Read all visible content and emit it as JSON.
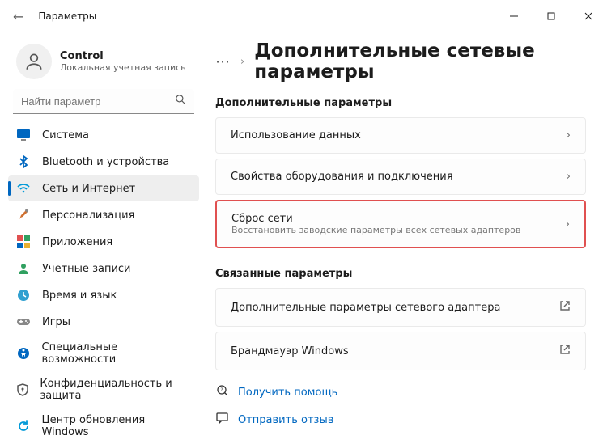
{
  "window": {
    "title": "Параметры"
  },
  "profile": {
    "name": "Control",
    "subtitle": "Локальная учетная запись"
  },
  "search": {
    "placeholder": "Найти параметр"
  },
  "sidebar": {
    "items": [
      {
        "label": "Система"
      },
      {
        "label": "Bluetooth и устройства"
      },
      {
        "label": "Сеть и Интернет"
      },
      {
        "label": "Персонализация"
      },
      {
        "label": "Приложения"
      },
      {
        "label": "Учетные записи"
      },
      {
        "label": "Время и язык"
      },
      {
        "label": "Игры"
      },
      {
        "label": "Специальные возможности"
      },
      {
        "label": "Конфиденциальность и защита"
      },
      {
        "label": "Центр обновления Windows"
      }
    ],
    "selectedIndex": 2
  },
  "header": {
    "page_title": "Дополнительные сетевые параметры"
  },
  "sections": {
    "additional": {
      "title": "Дополнительные параметры",
      "cards": [
        {
          "title": "Использование данных"
        },
        {
          "title": "Свойства оборудования и подключения"
        },
        {
          "title": "Сброс сети",
          "sub": "Восстановить заводские параметры всех сетевых адаптеров"
        }
      ]
    },
    "related": {
      "title": "Связанные параметры",
      "cards": [
        {
          "title": "Дополнительные параметры сетевого адаптера"
        },
        {
          "title": "Брандмауэр Windows"
        }
      ]
    }
  },
  "help": {
    "get_help": "Получить помощь",
    "feedback": "Отправить отзыв"
  }
}
